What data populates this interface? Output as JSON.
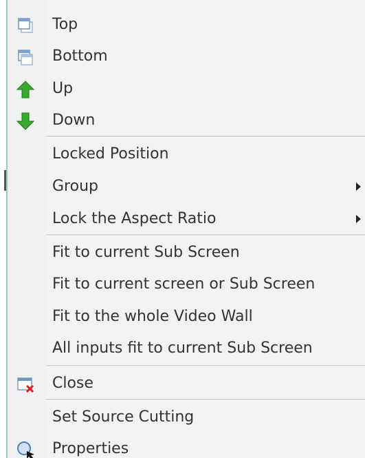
{
  "menu": {
    "items": [
      {
        "label": "Top",
        "icon": "bring-to-top-icon"
      },
      {
        "label": "Bottom",
        "icon": "send-to-bottom-icon"
      },
      {
        "label": "Up",
        "icon": "arrow-up-icon"
      },
      {
        "label": "Down",
        "icon": "arrow-down-icon"
      },
      {
        "label": "Locked Position"
      },
      {
        "label": "Group",
        "submenu": true
      },
      {
        "label": "Lock the Aspect Ratio",
        "submenu": true
      },
      {
        "label": "Fit to current Sub Screen"
      },
      {
        "label": "Fit to current screen or Sub Screen"
      },
      {
        "label": "Fit to the whole Video Wall"
      },
      {
        "label": "All inputs fit to current Sub Screen"
      },
      {
        "label": "Close",
        "icon": "close-window-icon"
      },
      {
        "label": "Set Source Cutting"
      },
      {
        "label": "Properties",
        "icon": "properties-magnifier-icon"
      }
    ]
  },
  "colors": {
    "menu_background": "#f2f2f2",
    "text": "#333333",
    "separator": "#d8d8d8",
    "arrow_green": "#3aa832"
  }
}
